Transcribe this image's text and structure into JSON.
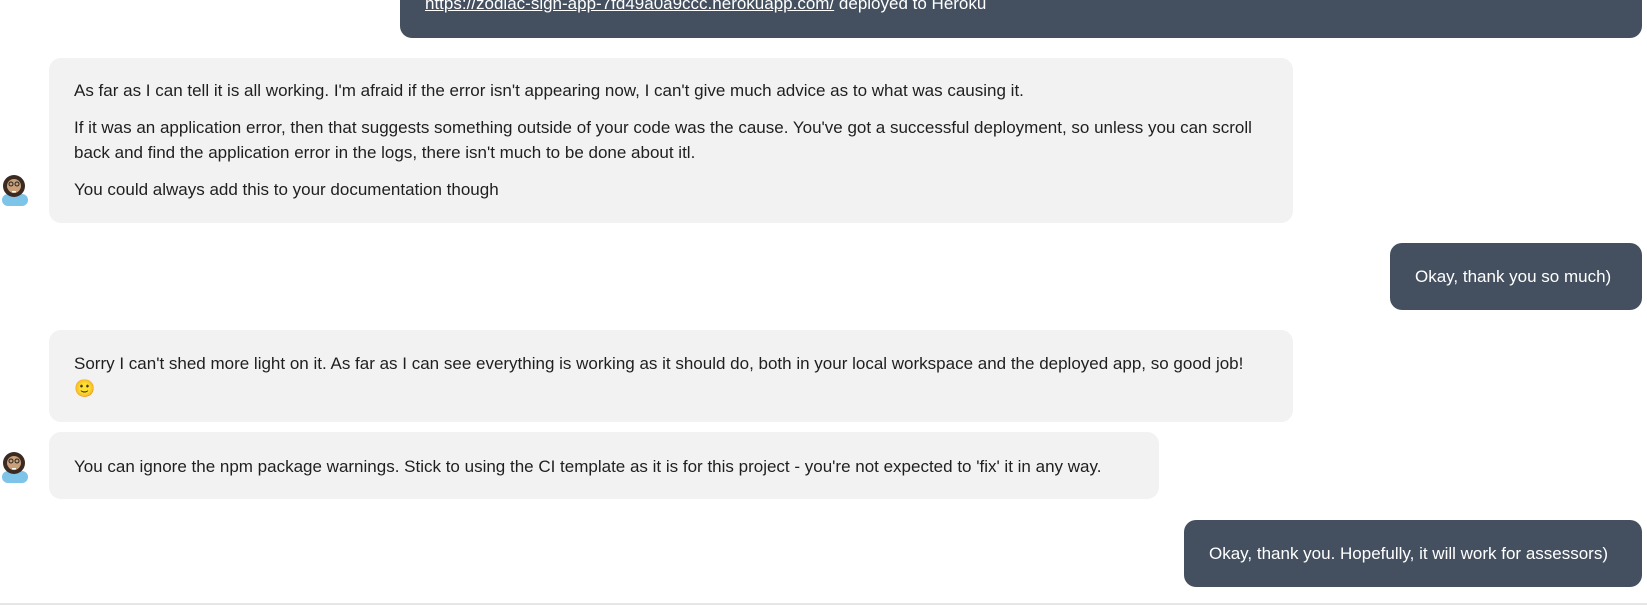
{
  "messages": [
    {
      "side": "right",
      "link": "https://zodiac-sign-app-7fd49a0a9ccc.herokuapp.com/",
      "text": " deployed to Heroku"
    },
    {
      "side": "left",
      "paragraphs": [
        "As far as I can tell it is all working. I'm afraid if the error isn't appearing now, I can't give much advice as to what was causing it.",
        "If it was an application error, then that suggests something outside of your code was the cause. You've got a successful deployment, so unless you can scroll back and find the application error in the logs, there isn't much to be done about itl.",
        "You could always add this to your documentation though"
      ]
    },
    {
      "side": "right",
      "text": "Okay, thank you so much)"
    },
    {
      "side": "left",
      "text": "Sorry I can't shed more light on it. As far as I can see everything is working as it should do, both in your local workspace and the deployed app, so good job!",
      "emoji": "🙂"
    },
    {
      "side": "left",
      "text": "You can ignore the npm package warnings. Stick to using the CI template as it is for this project - you're not expected to 'fix' it in any way."
    },
    {
      "side": "right",
      "text": "Okay, thank you. Hopefully, it will work for assessors)"
    }
  ],
  "icons": {
    "avatar": "bearded-man-avatar-icon"
  },
  "colors": {
    "incoming_bubble": "#f2f2f2",
    "outgoing_bubble": "#44505f",
    "incoming_text": "#1f1f1f",
    "outgoing_text": "#ffffff"
  }
}
